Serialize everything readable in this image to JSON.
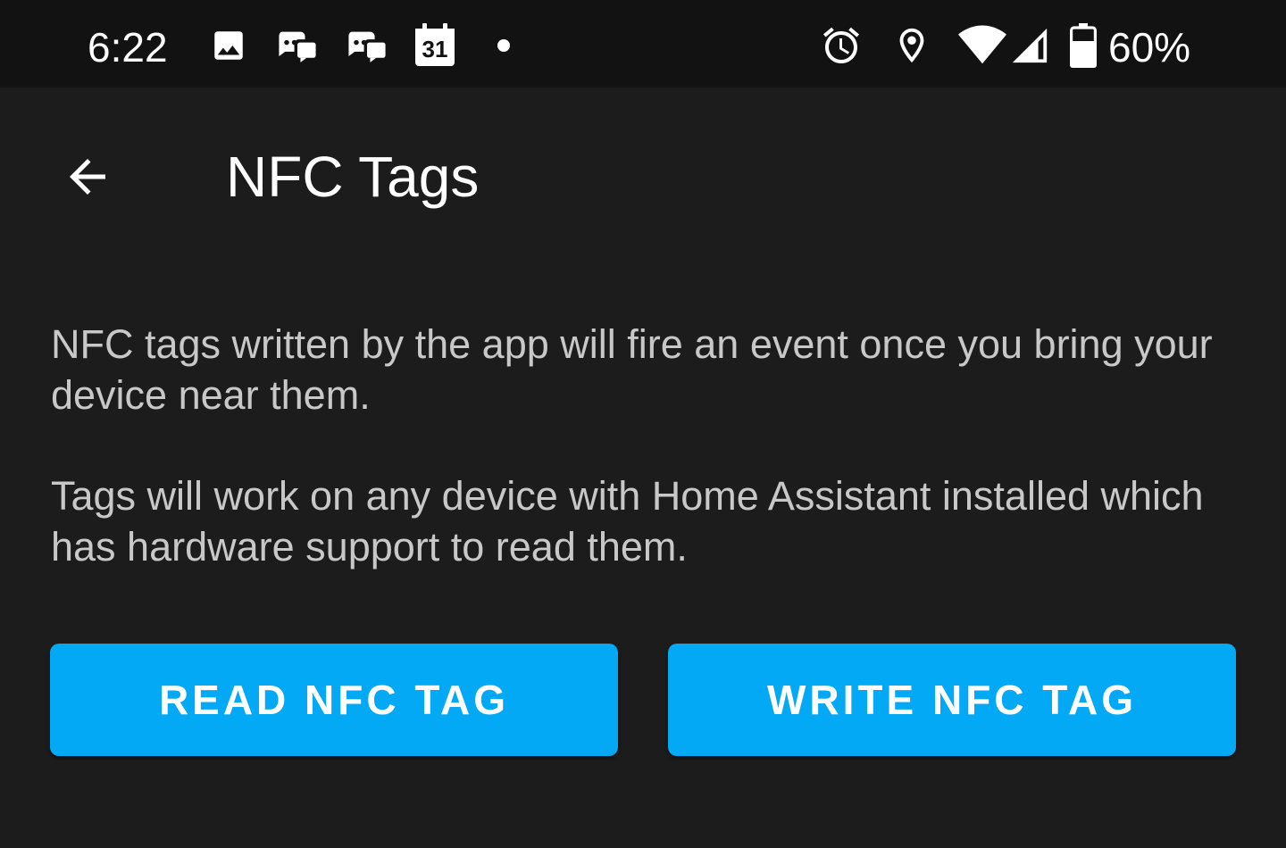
{
  "status_bar": {
    "time": "6:22",
    "notification_icons": [
      "image-icon",
      "discord-icon",
      "discord-icon",
      "calendar-icon",
      "dot-icon"
    ],
    "calendar_day": "31",
    "system_icons": [
      "alarm-icon",
      "location-icon",
      "wifi-icon",
      "cell-signal-icon",
      "battery-icon"
    ],
    "battery_percent": "60%"
  },
  "app_bar": {
    "back_icon": "arrow-back-icon",
    "title": "NFC Tags"
  },
  "content": {
    "paragraph_1": "NFC tags written by the app will fire an event once you bring your device near them.",
    "paragraph_2": "Tags will work on any device with Home Assistant installed which has hardware support to read them."
  },
  "actions": {
    "read_label": "READ NFC TAG",
    "write_label": "WRITE NFC TAG"
  },
  "colors": {
    "background": "#1c1c1c",
    "status_bar": "#121212",
    "accent": "#03a9f4",
    "body_text": "#c8c8c8"
  }
}
